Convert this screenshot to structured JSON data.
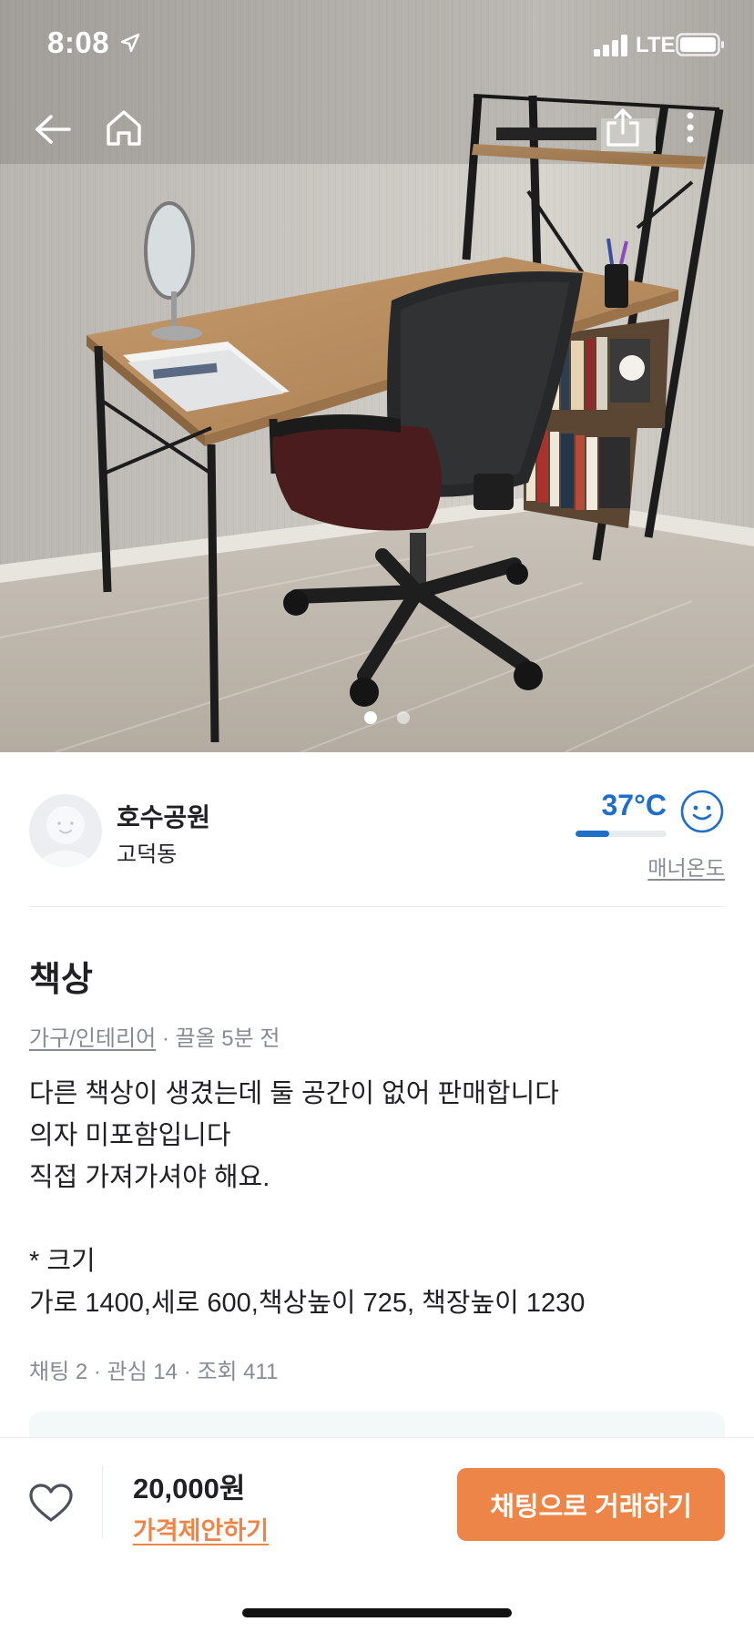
{
  "status_bar": {
    "time": "8:08",
    "network": "LTE"
  },
  "top_nav": {
    "icons": [
      "back-arrow-icon",
      "home-icon",
      "share-icon",
      "more-vertical-icon"
    ]
  },
  "gallery": {
    "image_count": 2,
    "current_index": 1
  },
  "seller": {
    "name": "호수공원",
    "location": "고덕동",
    "temperature": "37°C",
    "temperature_fill": 0.37,
    "manner_label": "매너온도"
  },
  "item": {
    "title": "책상",
    "category": "가구/인테리어",
    "time_info": " · 끌올 5분 전",
    "description": [
      "다른 책상이 생겼는데 둘 공간이 없어 판매합니다",
      "의자 미포함입니다",
      "직접 가져가셔야 해요.",
      "",
      "* 크기",
      "가로 1400,세로 600,책상높이 725, 책장높이 1230"
    ],
    "stats": "채팅 2 · 관심 14 · 조회 411"
  },
  "bottom_bar": {
    "price": "20,000원",
    "offer_label": "가격제안하기",
    "chat_button": "채팅으로 거래하기"
  },
  "colors": {
    "accent": "#ee8548",
    "temperature": "#1f6fc6",
    "muted": "#868b94"
  }
}
